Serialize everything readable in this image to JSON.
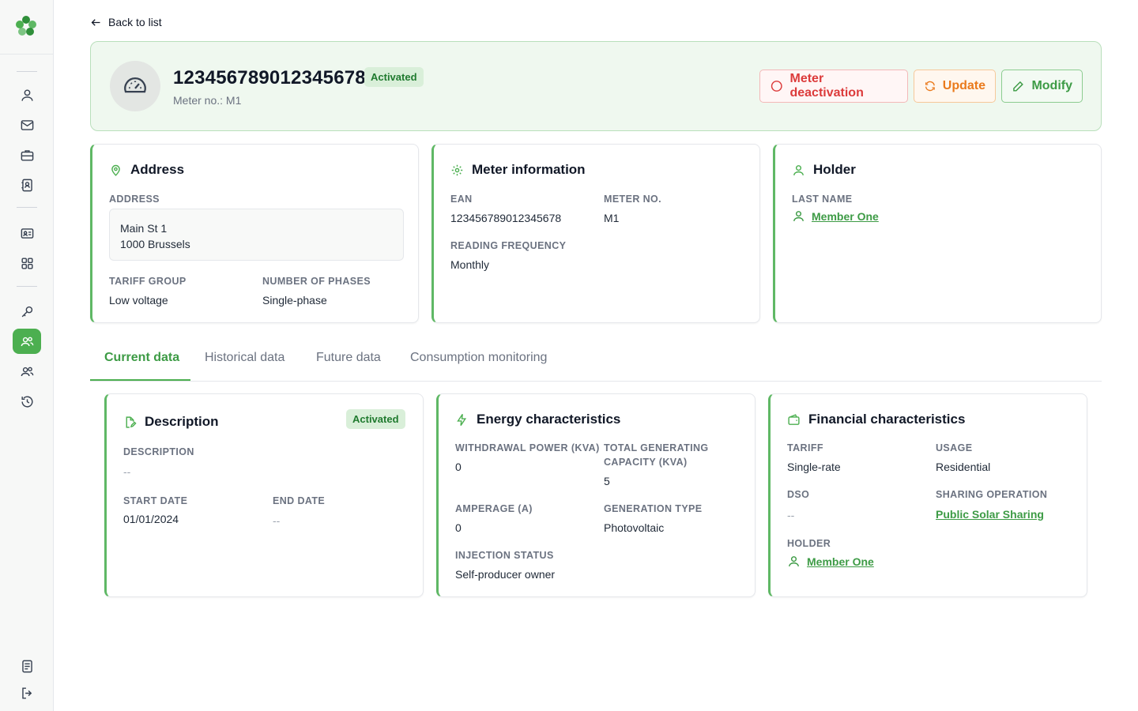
{
  "nav": {
    "back_label": "Back to list"
  },
  "header": {
    "ean": "123456789012345678",
    "status": "Activated",
    "meter_no": "Meter no.: M1",
    "buttons": {
      "deactivate": "Meter deactivation",
      "update": "Update",
      "modify": "Modify"
    }
  },
  "address_card": {
    "title": "Address",
    "address_label": "ADDRESS",
    "address_line1": "Main St 1",
    "address_line2": "1000 Brussels",
    "tariff_group_label": "TARIFF GROUP",
    "tariff_group": "Low voltage",
    "phases_label": "NUMBER OF PHASES",
    "phases": "Single-phase"
  },
  "meter_card": {
    "title": "Meter information",
    "ean_label": "EAN",
    "ean": "123456789012345678",
    "meter_no_label": "METER NO.",
    "meter_no": "M1",
    "frequency_label": "READING FREQUENCY",
    "frequency": "Monthly"
  },
  "holder_card": {
    "title": "Holder",
    "last_name_label": "LAST NAME",
    "last_name": "Member One"
  },
  "tabs": [
    {
      "label": "Current data",
      "active": true
    },
    {
      "label": "Historical data",
      "active": false
    },
    {
      "label": "Future data",
      "active": false
    },
    {
      "label": "Consumption monitoring",
      "active": false
    }
  ],
  "description_card": {
    "title": "Description",
    "status": "Activated",
    "description_label": "DESCRIPTION",
    "description": "--",
    "start_date_label": "START DATE",
    "start_date": "01/01/2024",
    "end_date_label": "END DATE",
    "end_date": "--"
  },
  "energy_card": {
    "title": "Energy characteristics",
    "withdrawal_label": "WITHDRAWAL POWER (KVA)",
    "withdrawal": "0",
    "generating_label_1": "TOTAL GENERATING",
    "generating_label_2": "CAPACITY (KVA)",
    "generating": "5",
    "amperage_label": "AMPERAGE (A)",
    "amperage": "0",
    "generation_type_label": "GENERATION TYPE",
    "generation_type": "Photovoltaic",
    "injection_label": "INJECTION STATUS",
    "injection": "Self-producer owner"
  },
  "financial_card": {
    "title": "Financial characteristics",
    "tariff_label": "TARIFF",
    "tariff": "Single-rate",
    "usage_label": "USAGE",
    "usage": "Residential",
    "dso_label": "DSO",
    "dso": "--",
    "sharing_label": "SHARING OPERATION",
    "sharing": "Public Solar Sharing",
    "holder_label": "HOLDER",
    "holder": "Member One"
  },
  "colors": {
    "accent": "#4caf50",
    "danger": "#dc3b3b",
    "warning": "#ea7a1c",
    "header_bg": "#eff8ef"
  }
}
